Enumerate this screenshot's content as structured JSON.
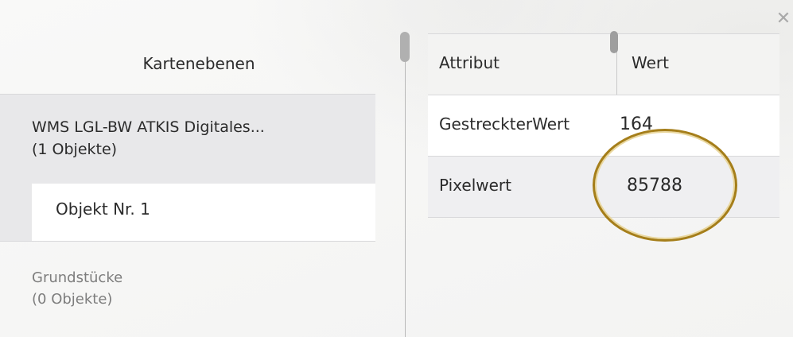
{
  "left_panel": {
    "header": "Kartenebenen",
    "layers": [
      {
        "title": "WMS LGL-BW ATKIS Digitales...",
        "count": "(1 Objekte)"
      },
      {
        "title": "Grundstücke",
        "count": "(0 Objekte)"
      }
    ],
    "object_item": "Objekt Nr. 1"
  },
  "table": {
    "columns": [
      "Attribut",
      "Wert"
    ],
    "rows": [
      {
        "attribute": "GestreckterWert",
        "value": "164"
      },
      {
        "attribute": "Pixelwert",
        "value": "85788"
      }
    ]
  },
  "icons": {
    "close": "close-icon"
  },
  "colors": {
    "highlight_ring": "#a57e1a",
    "selected_row": "#e8e8ea"
  }
}
